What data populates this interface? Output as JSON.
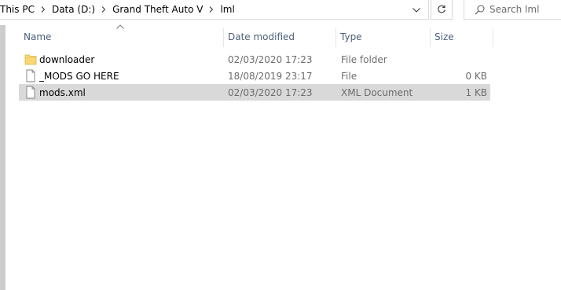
{
  "breadcrumb": {
    "items": [
      "This PC",
      "Data (D:)",
      "Grand Theft Auto V",
      "lml"
    ]
  },
  "search": {
    "placeholder": "Search lml"
  },
  "columns": {
    "name": "Name",
    "date": "Date modified",
    "type": "Type",
    "size": "Size"
  },
  "files": [
    {
      "name": "downloader",
      "date": "02/03/2020 17:23",
      "type": "File folder",
      "size": "",
      "icon": "folder-icon"
    },
    {
      "name": "_MODS GO HERE",
      "date": "18/08/2019 23:17",
      "type": "File",
      "size": "0 KB",
      "icon": "file-icon"
    },
    {
      "name": "mods.xml",
      "date": "02/03/2020 17:23",
      "type": "XML Document",
      "size": "1 KB",
      "icon": "file-icon"
    }
  ],
  "colors": {
    "selection": "#d9d9d9",
    "header_text": "#4c607a",
    "folder": "#f8d775"
  }
}
